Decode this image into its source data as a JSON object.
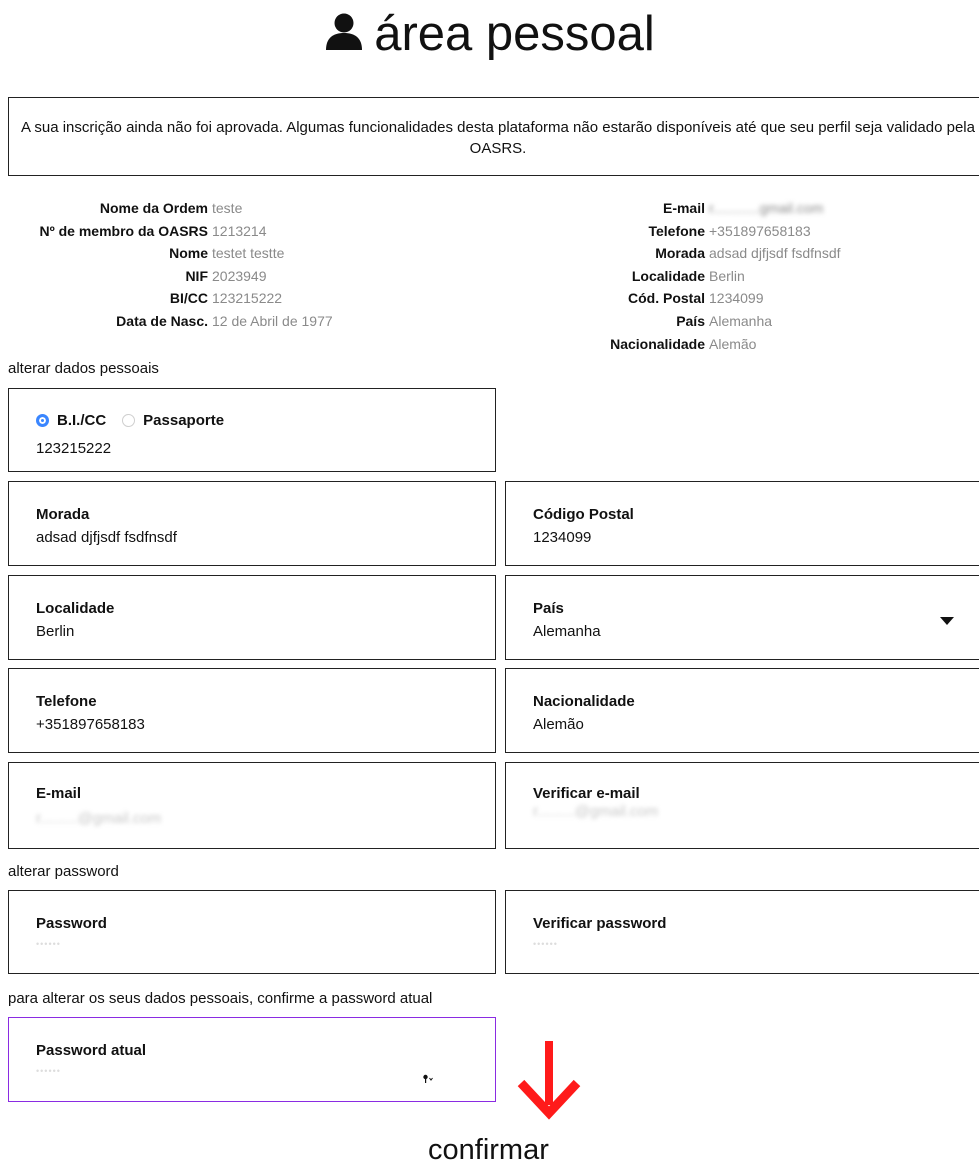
{
  "header": {
    "title": "área pessoal",
    "icon": "user-icon"
  },
  "notice": {
    "text": "A sua inscrição ainda não foi aprovada. Algumas funcionalidades desta plataforma não estarão disponíveis até que seu perfil seja validado pela OASRS."
  },
  "profile_left": [
    {
      "label": "Nome da Ordem",
      "value": "teste"
    },
    {
      "label": "Nº de membro da OASRS",
      "value": "1213214"
    },
    {
      "label": "Nome",
      "value": "testet testte"
    },
    {
      "label": "NIF",
      "value": "2023949"
    },
    {
      "label": "BI/CC",
      "value": "123215222"
    },
    {
      "label": "Data de Nasc.",
      "value": "12 de Abril de 1977"
    }
  ],
  "profile_right": [
    {
      "label": "E-mail",
      "value": "r............gmail.com"
    },
    {
      "label": "Telefone",
      "value": "+351897658183"
    },
    {
      "label": "Morada",
      "value": "adsad djfjsdf fsdfnsdf"
    },
    {
      "label": "Localidade",
      "value": "Berlin"
    },
    {
      "label": "Cód. Postal",
      "value": "1234099"
    },
    {
      "label": "País",
      "value": "Alemanha"
    },
    {
      "label": "Nacionalidade",
      "value": "Alemão"
    }
  ],
  "personal_section": {
    "heading": "alterar dados pessoais",
    "doc_type": {
      "option1": "B.I./CC",
      "option2": "Passaporte",
      "selected": "B.I./CC",
      "value": "123215222"
    },
    "morada": {
      "label": "Morada",
      "value": "adsad djfjsdf fsdfnsdf"
    },
    "codigo_postal": {
      "label": "Código Postal",
      "value": "1234099"
    },
    "localidade": {
      "label": "Localidade",
      "value": "Berlin"
    },
    "pais": {
      "label": "País",
      "value": "Alemanha"
    },
    "telefone": {
      "label": "Telefone",
      "value": "+351897658183"
    },
    "nacionalidade": {
      "label": "Nacionalidade",
      "value": "Alemão"
    },
    "email": {
      "label": "E-mail",
      "value": "r.........@gmail.com"
    },
    "verificar_email": {
      "label": "Verificar e-mail",
      "value": "r.........@gmail.com"
    }
  },
  "password_section": {
    "heading": "alterar password",
    "password": {
      "label": "Password",
      "value": "••••••"
    },
    "verificar_password": {
      "label": "Verificar password",
      "value": "••••••"
    }
  },
  "confirm_section": {
    "heading": "para alterar os seus dados pessoais, confirme a password atual",
    "password_atual": {
      "label": "Password atual",
      "value": "••••••"
    },
    "focus_color": "#8a2be2"
  },
  "annotation": {
    "arrow_color": "#ff1a1a",
    "confirm_label": "confirmar"
  }
}
